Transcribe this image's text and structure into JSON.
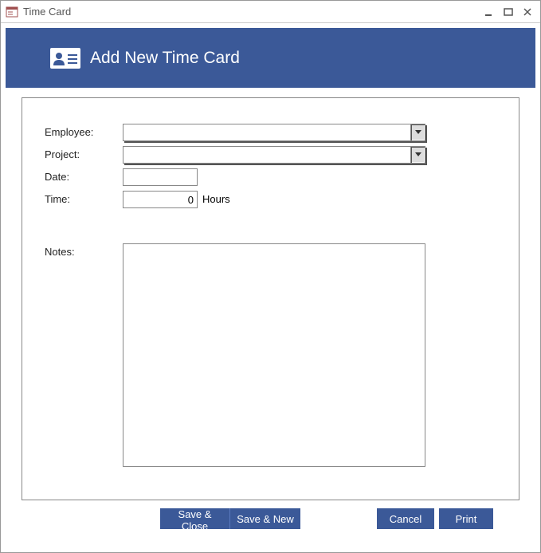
{
  "window": {
    "title": "Time Card"
  },
  "banner": {
    "title": "Add New Time Card"
  },
  "labels": {
    "employee": "Employee:",
    "project": "Project:",
    "date": "Date:",
    "time": "Time:",
    "time_unit": "Hours",
    "notes": "Notes:"
  },
  "values": {
    "employee": "",
    "project": "",
    "date": "",
    "time": "0",
    "notes": ""
  },
  "buttons": {
    "save_close": "Save & Close",
    "save_new": "Save & New",
    "cancel": "Cancel",
    "print": "Print"
  }
}
